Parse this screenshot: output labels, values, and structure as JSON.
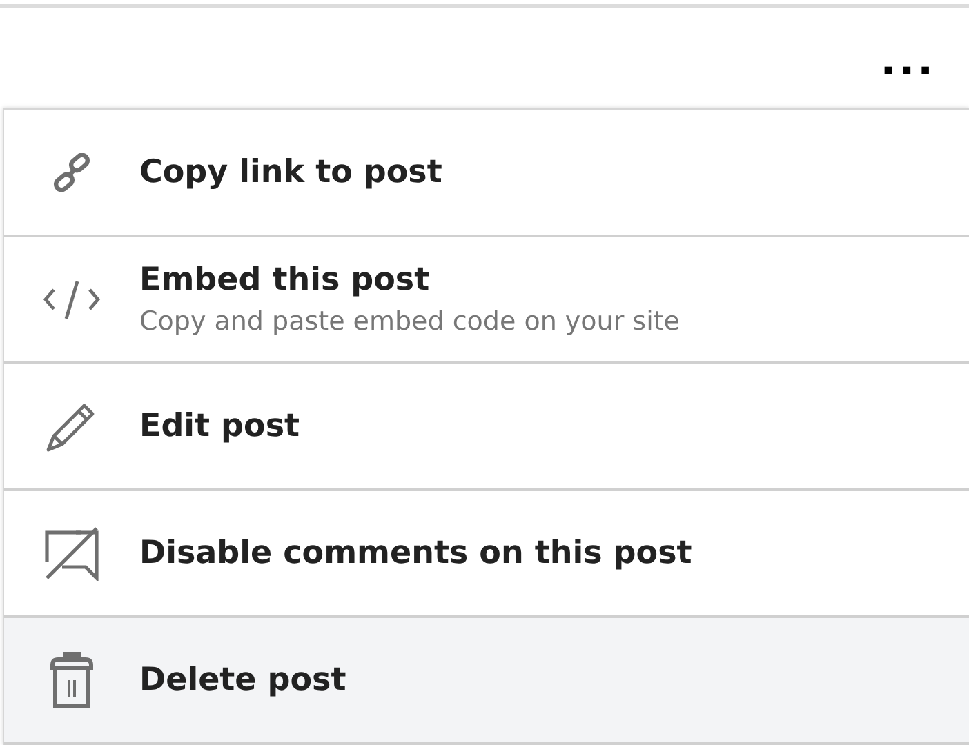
{
  "more_button": {
    "label": "..."
  },
  "menu": {
    "items": [
      {
        "kind": "link",
        "label": "Copy link to post",
        "selected": false
      },
      {
        "kind": "embed",
        "label": "Embed this post",
        "description": "Copy and paste embed code on your site",
        "selected": false
      },
      {
        "kind": "edit",
        "label": "Edit post",
        "selected": false
      },
      {
        "kind": "comments",
        "label": "Disable comments on this post",
        "selected": false
      },
      {
        "kind": "delete",
        "label": "Delete post",
        "selected": true
      }
    ]
  }
}
